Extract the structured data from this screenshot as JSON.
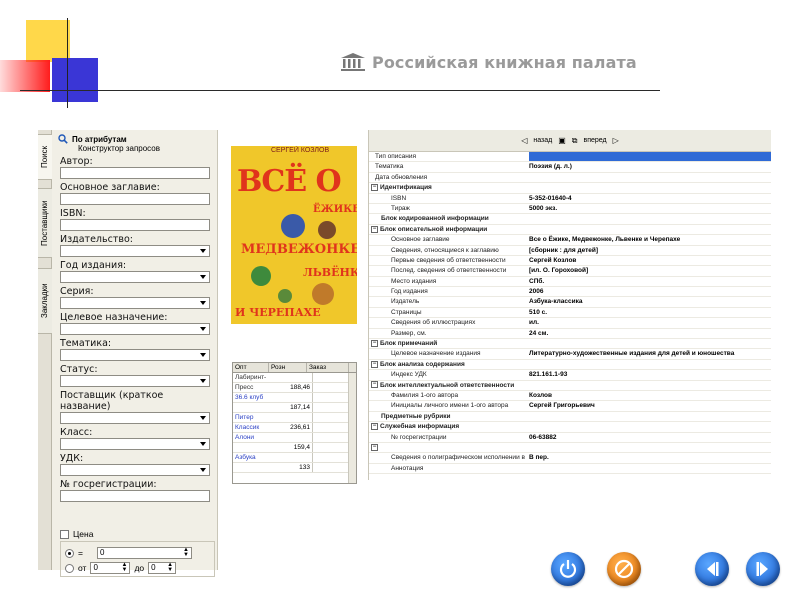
{
  "brand": {
    "title": "Российская книжная палата",
    "icon": "building-columns-icon"
  },
  "sidebar_tabs": [
    "Поиск",
    "Поставщики",
    "Закладки"
  ],
  "search": {
    "heading": "По атрибутам",
    "sub": "Конструктор запросов",
    "fields": [
      {
        "label": "Автор:",
        "kind": "text"
      },
      {
        "label": "Основное заглавие:",
        "kind": "text"
      },
      {
        "label": "ISBN:",
        "kind": "text"
      },
      {
        "label": "Издательство:",
        "kind": "select"
      },
      {
        "label": "Год издания:",
        "kind": "select"
      },
      {
        "label": "Серия:",
        "kind": "select"
      },
      {
        "label": "Целевое назначение:",
        "kind": "select"
      },
      {
        "label": "Тематика:",
        "kind": "select"
      },
      {
        "label": "Статус:",
        "kind": "select"
      },
      {
        "label": "Поставщик (краткое название)",
        "kind": "select"
      },
      {
        "label": "Класс:",
        "kind": "select"
      },
      {
        "label": "УДК:",
        "kind": "select"
      },
      {
        "label": "№ госрегистрации:",
        "kind": "text"
      }
    ],
    "price": {
      "label": "Цена",
      "eq_label": "=",
      "eq_value": "0",
      "from_label": "от",
      "from_value": "0",
      "to_label": "до",
      "to_value": "0"
    }
  },
  "cover": {
    "author": "СЕРГЕЙ КОЗЛОВ",
    "line1": "ВСЁ О",
    "line2": "ЁЖИКЕ,",
    "line3": "МЕДВЕЖОНКЕ,",
    "line4": "ЛЬВЁНКЕ",
    "line5": "И ЧЕРЕПАХЕ"
  },
  "price_grid": {
    "headers": [
      "Опт",
      "Розн",
      "Заказ"
    ],
    "rows": [
      {
        "name": "Лабиринт-Пресс",
        "value": ""
      },
      {
        "name": "",
        "value": "188,46"
      },
      {
        "name": "36.6 клуб",
        "value": ""
      },
      {
        "name": "",
        "value": "187,14"
      },
      {
        "name": "Питер Классик",
        "value": ""
      },
      {
        "name": "",
        "value": "236,61"
      },
      {
        "name": "Алони",
        "value": ""
      },
      {
        "name": "",
        "value": "159,4"
      },
      {
        "name": "Азбука",
        "value": ""
      },
      {
        "name": "",
        "value": "133"
      }
    ]
  },
  "toolbar": {
    "back": "назад",
    "forward": "вперед"
  },
  "record": [
    {
      "type": "row",
      "k": "Тип описания",
      "v": "",
      "selected": true
    },
    {
      "type": "row",
      "k": "Тематика",
      "v": "Поэзия (д. л.)"
    },
    {
      "type": "row",
      "k": "Дата обновления",
      "v": ""
    },
    {
      "type": "sec",
      "k": "Идентификация"
    },
    {
      "type": "child",
      "k": "ISBN",
      "v": "5-352-01640-4"
    },
    {
      "type": "child",
      "k": "Тираж",
      "v": "5000 экз."
    },
    {
      "type": "sec2",
      "k": "Блок кодированной информации"
    },
    {
      "type": "sec",
      "k": "Блок описательной информации"
    },
    {
      "type": "child",
      "k": "Основное заглавие",
      "v": "Все о Ёжике, Медвежонке, Львенке и Черепахе"
    },
    {
      "type": "child",
      "k": "Сведения, относящиеся к заглавию",
      "v": "[сборник : для детей]"
    },
    {
      "type": "child",
      "k": "Первые сведения об ответственности",
      "v": "Сергей Козлов"
    },
    {
      "type": "child",
      "k": "Послед. сведения об ответственности",
      "v": "[ил. О. Гороховой]"
    },
    {
      "type": "child",
      "k": "Место издания",
      "v": "СПб."
    },
    {
      "type": "child",
      "k": "Год издания",
      "v": "2006"
    },
    {
      "type": "child",
      "k": "Издатель",
      "v": "Азбука-классика"
    },
    {
      "type": "child",
      "k": "Страницы",
      "v": "510 с."
    },
    {
      "type": "child",
      "k": "Сведения об иллюстрациях",
      "v": "ил."
    },
    {
      "type": "child",
      "k": "Размер, см.",
      "v": "24 см."
    },
    {
      "type": "sec",
      "k": "Блок примечаний"
    },
    {
      "type": "child",
      "k": "Целевое назначение издания",
      "v": "Литературно-художественные издания для детей и юношества"
    },
    {
      "type": "sec",
      "k": "Блок анализа содержания"
    },
    {
      "type": "child",
      "k": "Индекс УДК",
      "v": "821.161.1-93"
    },
    {
      "type": "sec",
      "k": "Блок интеллектуальной ответственности"
    },
    {
      "type": "child",
      "k": "Фамилия 1-ого автора",
      "v": "Козлов"
    },
    {
      "type": "child",
      "k": "Инициалы личного имени 1-ого автора",
      "v": "Сергей Григорьевич"
    },
    {
      "type": "sec2",
      "k": "Предметные рубрики"
    },
    {
      "type": "sec",
      "k": "Служебная информация"
    },
    {
      "type": "child",
      "k": "№ госрегистрации",
      "v": "06-63882"
    },
    {
      "type": "sec",
      "k": ""
    },
    {
      "type": "child",
      "k": "Сведения о полиграфическом исполнении в",
      "v": "В пер."
    },
    {
      "type": "child",
      "k": "Аннотация",
      "v": ""
    }
  ],
  "nav_buttons": [
    "power-icon",
    "stop-icon",
    "prev-icon",
    "next-icon"
  ],
  "colors": {
    "accent": "#2f6ad6",
    "brand_gray": "#9a9a9a"
  }
}
